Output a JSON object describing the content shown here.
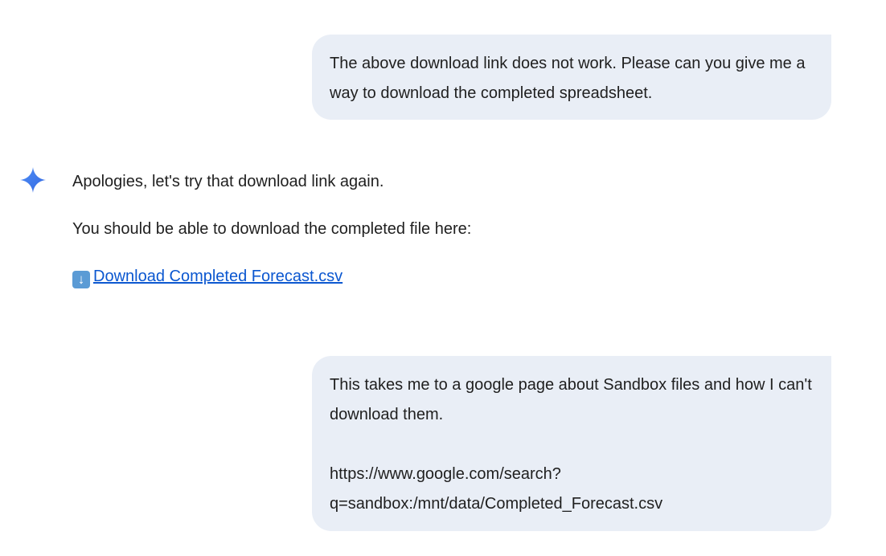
{
  "conversation": {
    "user_message_1": "The above download link does not work. Please can you give me a way to download the completed spreadsheet.",
    "ai_response": {
      "line_1": "Apologies, let's try that download link again.",
      "line_2": "You should be able to download the completed file here:",
      "link_icon": "download-arrow-emoji",
      "link_label": "Download Completed Forecast.csv"
    },
    "user_message_2": "This takes me to a google page about Sandbox files and how I can't download them.\n\nhttps://www.google.com/search?q=sandbox:/mnt/data/Completed_Forecast.csv"
  },
  "colors": {
    "user_bubble_bg": "#e9eef6",
    "link": "#0b57d0",
    "gem_icon": "#4285f4"
  }
}
